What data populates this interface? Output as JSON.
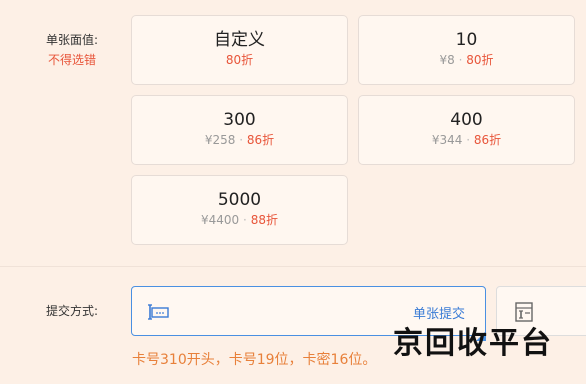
{
  "face_value": {
    "label": "单张面值:",
    "hint": "不得选错"
  },
  "cards": [
    {
      "title": "自定义",
      "price": "",
      "separator": "",
      "discount": "80折"
    },
    {
      "title": "10",
      "price": "¥8",
      "separator": "·",
      "discount": "80折"
    },
    {
      "title": "300",
      "price": "¥258",
      "separator": "·",
      "discount": "86折"
    },
    {
      "title": "400",
      "price": "¥344",
      "separator": "·",
      "discount": "86折"
    },
    {
      "title": "5000",
      "price": "¥4400",
      "separator": "·",
      "discount": "88折"
    }
  ],
  "submit": {
    "label": "提交方式:",
    "mode_single": "单张提交",
    "mode_single_icon": "keyboard-icon",
    "mode_batch_icon": "batch-document-icon",
    "rule": "卡号310开头，卡号19位，卡密16位。"
  },
  "watermark": "京回收平台",
  "colors": {
    "background": "#fdf0e6",
    "accent_red": "#e8553a",
    "accent_blue": "#4a90e2",
    "rule_orange": "#e8803a"
  }
}
